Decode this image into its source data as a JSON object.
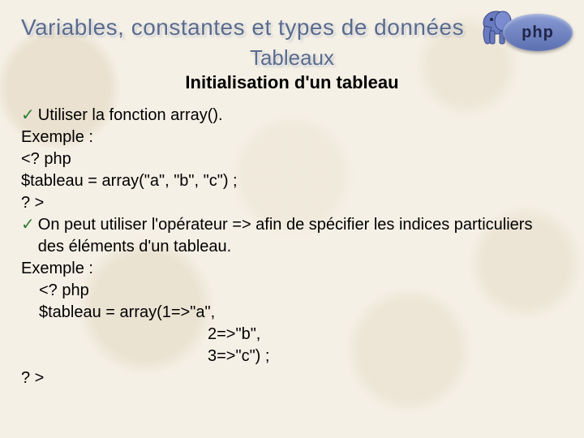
{
  "title": "Variables, constantes et types de données",
  "subtitle": "Tableaux",
  "heading": "Initialisation d'un tableau",
  "logo_text": "php",
  "bullets": {
    "b1": "Utiliser la fonction array().",
    "b2": "On peut utiliser l'opérateur => afin de spécifier les indices particuliers des éléments d'un tableau."
  },
  "lines": {
    "ex_label_1": "Exemple :",
    "open_tag_1": "<? php",
    "code_1": "$tableau = array(\"a\", \"b\", \"c\") ;",
    "close_tag_1": "? >",
    "ex_label_2": "Exemple :",
    "open_tag_2": "<? php",
    "code_2a": "$tableau = array(1=>\"a\",",
    "code_2b": "2=>\"b\",",
    "code_2c": "3=>\"c\") ;",
    "close_tag_2": "? >"
  }
}
